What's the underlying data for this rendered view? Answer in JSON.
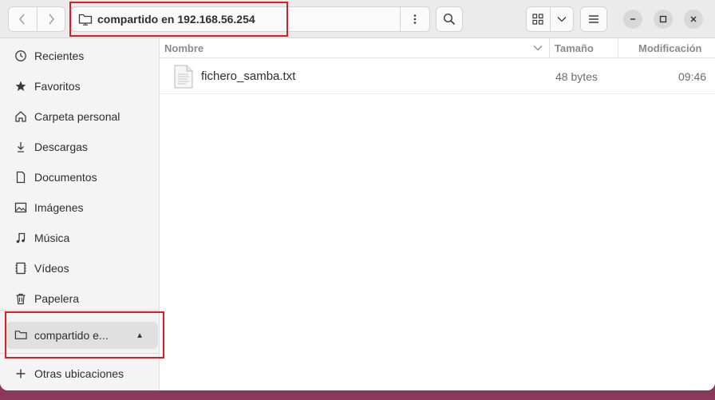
{
  "header": {
    "path_label": "compartido en 192.168.56.254"
  },
  "sidebar": {
    "items": [
      {
        "label": "Recientes",
        "icon": "clock-icon"
      },
      {
        "label": "Favoritos",
        "icon": "star-icon"
      },
      {
        "label": "Carpeta personal",
        "icon": "home-icon"
      },
      {
        "label": "Descargas",
        "icon": "download-icon"
      },
      {
        "label": "Documentos",
        "icon": "document-icon"
      },
      {
        "label": "Imágenes",
        "icon": "image-icon"
      },
      {
        "label": "Música",
        "icon": "music-icon"
      },
      {
        "label": "Vídeos",
        "icon": "video-icon"
      },
      {
        "label": "Papelera",
        "icon": "trash-icon"
      }
    ],
    "mounted": {
      "label": "compartido e...",
      "icon": "network-folder-icon"
    },
    "other_locations": {
      "label": "Otras ubicaciones",
      "icon": "plus-icon"
    }
  },
  "columns": {
    "name": "Nombre",
    "size": "Tamaño",
    "modified": "Modificación"
  },
  "files": [
    {
      "name": "fichero_samba.txt",
      "size": "48 bytes",
      "modified": "09:46",
      "icon": "text-file-icon"
    }
  ],
  "colors": {
    "annotation": "#e01b24",
    "header_bg": "#ebebeb",
    "sidebar_bg": "#f4f4f4"
  }
}
